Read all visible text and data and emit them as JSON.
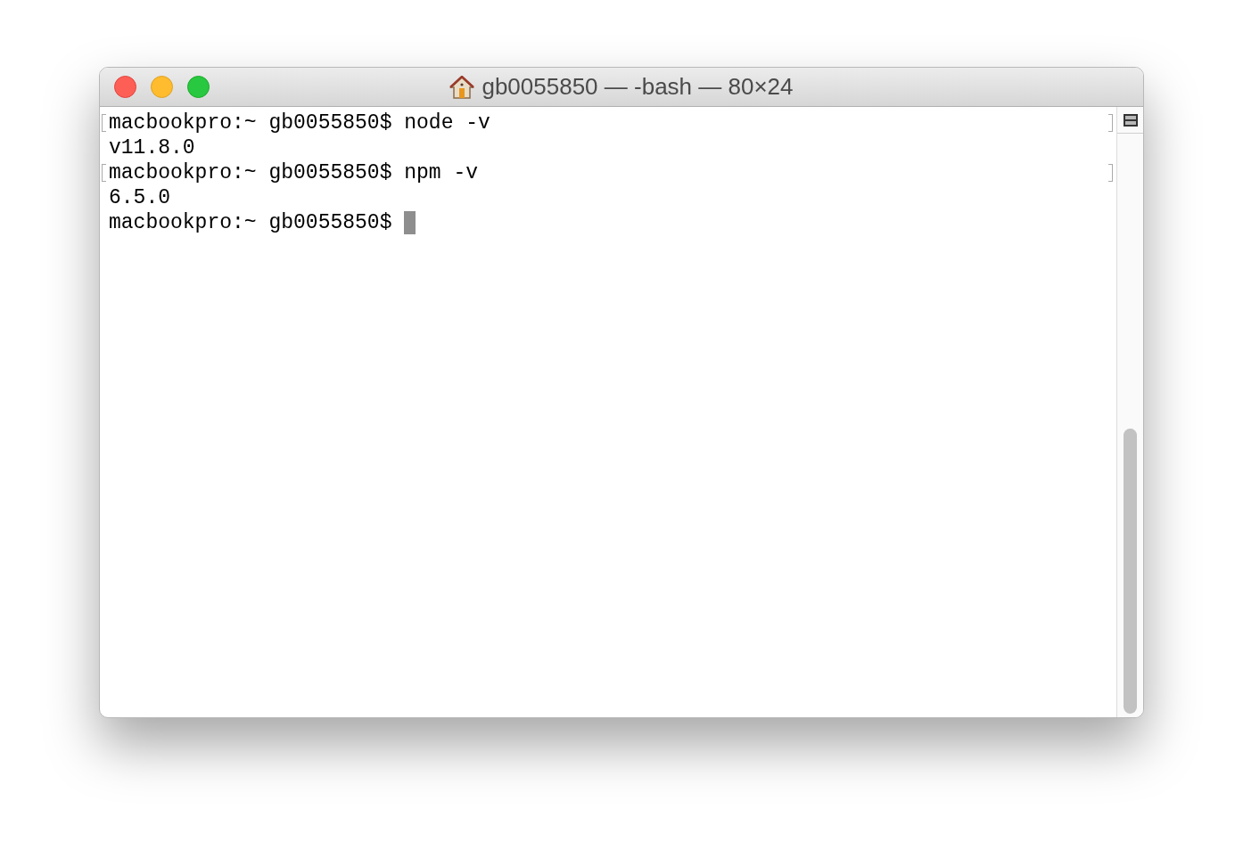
{
  "window": {
    "title": "gb0055850 — -bash — 80×24"
  },
  "terminal": {
    "lines": [
      {
        "text": "macbookpro:~ gb0055850$ node -v",
        "marked": true,
        "cursor": false
      },
      {
        "text": "v11.8.0",
        "marked": false,
        "cursor": false
      },
      {
        "text": "macbookpro:~ gb0055850$ npm -v",
        "marked": true,
        "cursor": false
      },
      {
        "text": "6.5.0",
        "marked": false,
        "cursor": false
      },
      {
        "text": "macbookpro:~ gb0055850$ ",
        "marked": false,
        "cursor": true
      }
    ]
  }
}
